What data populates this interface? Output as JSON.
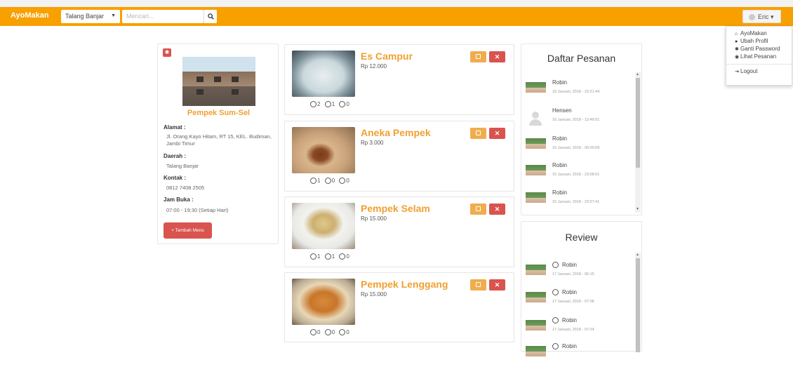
{
  "navbar": {
    "brand": "AyoMakan",
    "location": "Talang Banjar",
    "search_placeholder": "Mencari...",
    "user_label": "Eric",
    "dropdown": [
      "AyoMakan",
      "Ubah Profil",
      "Ganti Password",
      "Lihat Pesanan"
    ],
    "logout": "Logout",
    "accent": "#f7a000"
  },
  "store": {
    "name": "Pempek Sum-Sel",
    "alamat_label": "Alamat :",
    "alamat": "Jl. Orang Kayo Hitam, RT 15, KEL. Budiman, Jambi Timur",
    "daerah_label": "Daerah :",
    "daerah": "Talang Banjar",
    "kontak_label": "Kontak :",
    "kontak": "0812 7408 2505",
    "jam_label": "Jam Buka :",
    "jam": "07:00 - 19:30 (Setiap Hari)",
    "add_menu": "Tambah Menu"
  },
  "menus": [
    {
      "name": "Es Campur",
      "price": "Rp 12.000",
      "happy": "2",
      "neutral": "1",
      "sad": "0"
    },
    {
      "name": "Aneka Pempek",
      "price": "Rp 3.000",
      "happy": "1",
      "neutral": "0",
      "sad": "0"
    },
    {
      "name": "Pempek Selam",
      "price": "Rp 15.000",
      "happy": "1",
      "neutral": "1",
      "sad": "0"
    },
    {
      "name": "Pempek Lenggang",
      "price": "Rp 15.000",
      "happy": "0",
      "neutral": "0",
      "sad": "0"
    }
  ],
  "orders": {
    "title": "Daftar Pesanan",
    "items": [
      {
        "name": "Robin",
        "time": "18 Januari, 2018 - 10:21:44"
      },
      {
        "name": "Hensen",
        "time": "16 Januari, 2018 - 13:46:01"
      },
      {
        "name": "Robin",
        "time": "16 Januari, 2018 - 00:00:09"
      },
      {
        "name": "Robin",
        "time": "15 Januari, 2018 - 23:58:01"
      },
      {
        "name": "Robin",
        "time": "15 Januari, 2018 - 23:57:41"
      }
    ]
  },
  "reviews": {
    "title": "Review",
    "items": [
      {
        "name": "Robin",
        "time": "17 Januari, 2018 - 06:15"
      },
      {
        "name": "Robin",
        "time": "17 Januari, 2018 - 07:08"
      },
      {
        "name": "Robin",
        "time": "17 Januari, 2018 - 07:24"
      },
      {
        "name": "Robin",
        "time": ""
      }
    ]
  }
}
